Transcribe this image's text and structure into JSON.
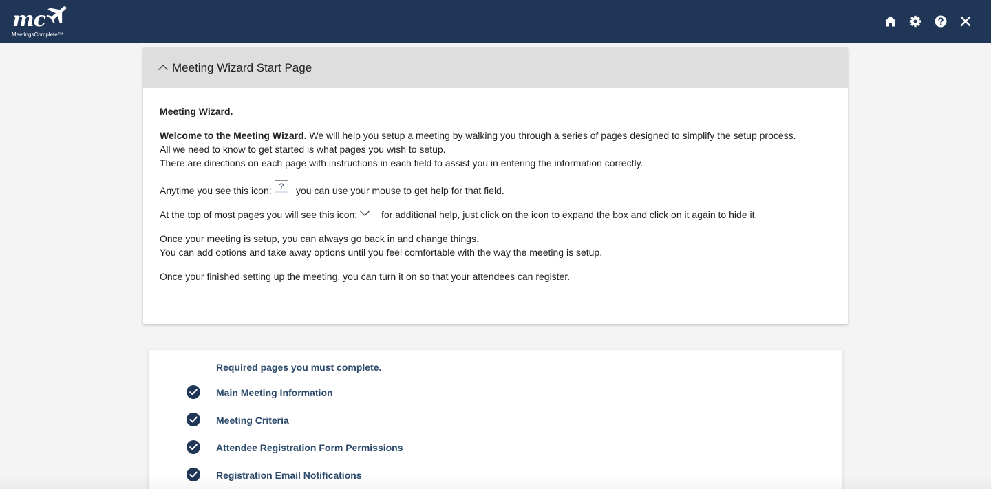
{
  "app": {
    "logo_mark": "mc",
    "logo_name": "MeetingsComplete™"
  },
  "toolbar": {
    "icons": [
      "home-icon",
      "gear-icon",
      "help-icon",
      "close-icon"
    ]
  },
  "panel": {
    "title": "Meeting Wizard Start Page",
    "heading": "Meeting Wizard.",
    "welcome_bold": "Welcome to the Meeting Wizard.",
    "welcome_rest": " We will help you setup a meeting by walking you through a series of pages designed to simplify the setup process.",
    "line_2": "All we need to know to get started is what pages you wish to setup.",
    "line_3": "There are directions on each page with instructions in each field to assist you in entering the information correctly.",
    "help_icon_before": "Anytime you see this icon:",
    "help_icon_glyph": "?",
    "help_icon_after": "you can use your mouse to get help for that field.",
    "expand_icon_before": "At the top of most pages you will see this icon:",
    "expand_icon_after": "for additional help, just click on the icon to expand the box and click on it again to hide it.",
    "line_6": "Once your meeting is setup, you can always go back in and change things.",
    "line_7": "You can add options and take away options until you feel comfortable with the way the meeting is setup.",
    "line_8": "Once your finished setting up the meeting, you can turn it on so that your attendees can register."
  },
  "required": {
    "title": "Required pages you must complete.",
    "items": [
      {
        "label": "Main Meeting Information",
        "complete": true
      },
      {
        "label": "Meeting Criteria",
        "complete": true
      },
      {
        "label": "Attendee Registration Form Permissions",
        "complete": true
      },
      {
        "label": "Registration Email Notifications",
        "complete": true
      }
    ]
  },
  "colors": {
    "topbar": "#203657",
    "header_bg": "#dedede",
    "link": "#2c4a6b",
    "page_bg": "#f4f4f4"
  }
}
